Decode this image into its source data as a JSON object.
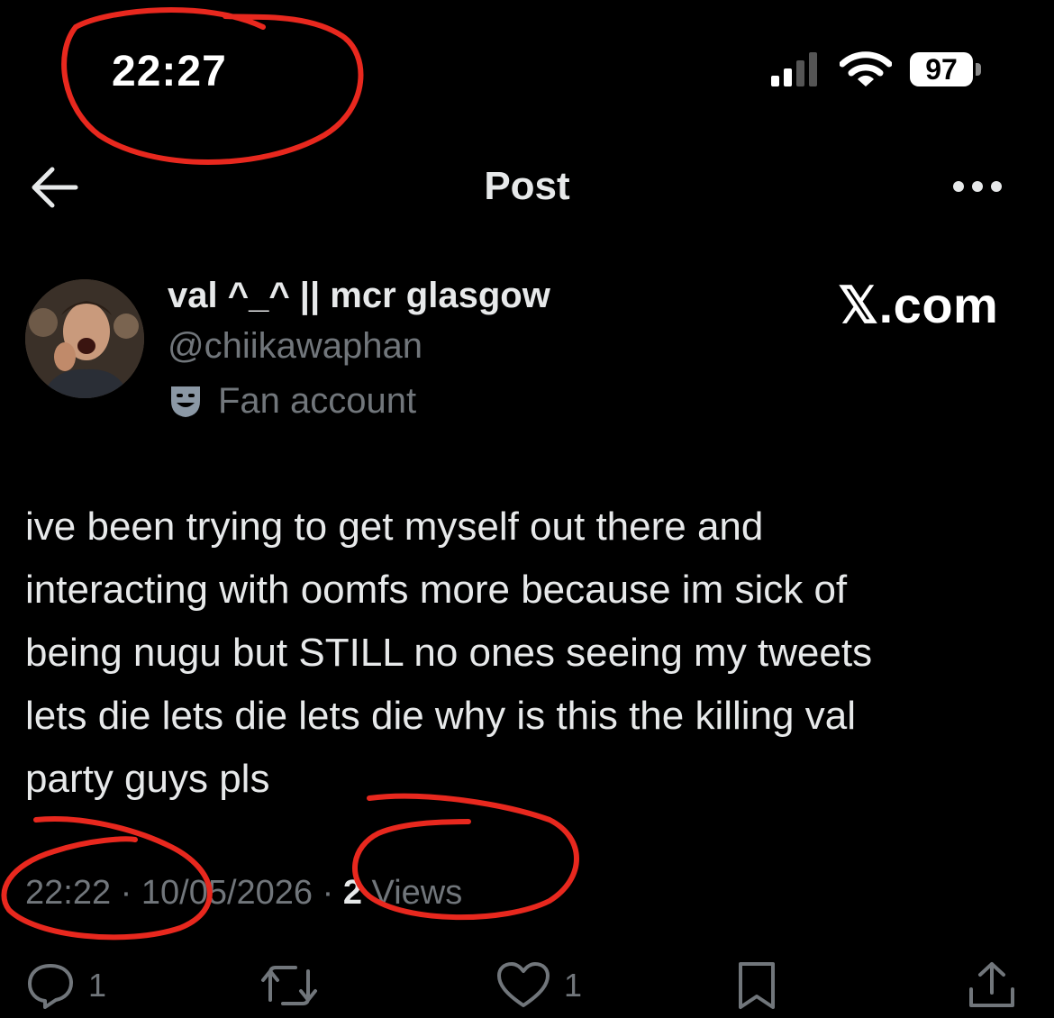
{
  "status_bar": {
    "time": "22:27",
    "battery": "97"
  },
  "header": {
    "title": "Post"
  },
  "author": {
    "display_name": "val ^_^ || mcr glasgow",
    "handle": "@chiikawaphan",
    "badge": "Fan account"
  },
  "watermark": "𝕏.com",
  "tweet": {
    "text": "ive been trying to get myself out there and\ninteracting with oomfs more because im sick of\nbeing nugu but STILL no ones seeing my tweets\nlets die lets die lets die why is this the killing val\nparty guys pls",
    "time": "22:22",
    "date": "10/05/2026",
    "views_count": "2",
    "views_label": "Views",
    "separator": "·"
  },
  "actions": {
    "replies": "1",
    "likes": "1"
  },
  "colors": {
    "annotation": "#e8281e",
    "muted": "#71767b",
    "text": "#e7e9ea"
  }
}
